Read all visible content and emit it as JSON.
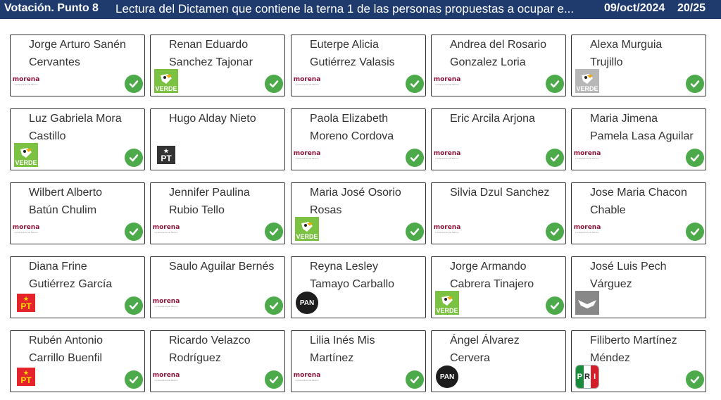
{
  "header": {
    "title": "Votación. Punto 8",
    "subject": "Lectura del Dictamen que contiene la terna 1 de las personas propuestas a ocupar e...",
    "date": "09/oct/2024",
    "count": "20/25"
  },
  "colors": {
    "header_bg": "#1f3a6d",
    "check": "#4caa4a",
    "morena": "#8a1538",
    "verde": "#7cc242"
  },
  "party_labels": {
    "morena": "morena",
    "morena_tagline": "La Esperanza de México",
    "verde": "VERDE",
    "pt": "PT",
    "pan": "PAN",
    "pri": [
      "P",
      "R",
      "I"
    ]
  },
  "candidates": [
    {
      "line1": "Jorge Arturo Sanén",
      "line2": "Cervantes",
      "party": "morena",
      "voted": true
    },
    {
      "line1": "Renan Eduardo",
      "line2": "Sanchez Tajonar",
      "party": "verde",
      "voted": true
    },
    {
      "line1": "Euterpe Alicia",
      "line2": "Gutiérrez Valasis",
      "party": "morena",
      "voted": true
    },
    {
      "line1": "Andrea del Rosario",
      "line2": "Gonzalez Loria",
      "party": "morena",
      "voted": true
    },
    {
      "line1": "Alexa Murguia",
      "line2": "Trujillo",
      "party": "verde-gray",
      "voted": true
    },
    {
      "line1": "Luz Gabriela Mora",
      "line2": "Castillo",
      "party": "verde",
      "voted": true
    },
    {
      "line1": "Hugo Alday Nieto",
      "line2": "",
      "party": "pt",
      "voted": false
    },
    {
      "line1": "Paola Elizabeth",
      "line2": "Moreno Cordova",
      "party": "morena",
      "voted": true
    },
    {
      "line1": "Eric Arcila Arjona",
      "line2": "",
      "party": "morena",
      "voted": true
    },
    {
      "line1": "Maria Jimena",
      "line2": "Pamela Lasa Aguilar",
      "party": "morena",
      "voted": true
    },
    {
      "line1": "Wilbert Alberto",
      "line2": "Batún Chulim",
      "party": "morena",
      "voted": true
    },
    {
      "line1": "Jennifer Paulina",
      "line2": "Rubio Tello",
      "party": "morena",
      "voted": true
    },
    {
      "line1": "Maria José Osorio",
      "line2": "Rosas",
      "party": "verde",
      "voted": true
    },
    {
      "line1": "Silvia Dzul Sanchez",
      "line2": "",
      "party": "morena",
      "voted": true
    },
    {
      "line1": "Jose Maria Chacon",
      "line2": "Chable",
      "party": "morena",
      "voted": true
    },
    {
      "line1": "Diana Frine",
      "line2": "Gutiérrez García",
      "party": "pt-red",
      "voted": true
    },
    {
      "line1": "Saulo Aguilar Bernés",
      "line2": "",
      "party": "morena",
      "voted": true
    },
    {
      "line1": "Reyna Lesley",
      "line2": "Tamayo Carballo",
      "party": "pan",
      "voted": false
    },
    {
      "line1": "Jorge Armando",
      "line2": "Cabrera Tinajero",
      "party": "verde",
      "voted": true
    },
    {
      "line1": "José Luis Pech",
      "line2": "Várguez",
      "party": "mc",
      "voted": false
    },
    {
      "line1": "Rubén Antonio",
      "line2": "Carrillo Buenfil",
      "party": "pt-red",
      "voted": true
    },
    {
      "line1": "Ricardo Velazco",
      "line2": "Rodríguez",
      "party": "morena",
      "voted": true
    },
    {
      "line1": "Lilia Inés Mis",
      "line2": "Martínez",
      "party": "morena",
      "voted": true
    },
    {
      "line1": "Ángel Álvarez",
      "line2": "Cervera",
      "party": "pan",
      "voted": false
    },
    {
      "line1": "Filiberto Martínez",
      "line2": "Méndez",
      "party": "pri",
      "voted": true
    }
  ]
}
